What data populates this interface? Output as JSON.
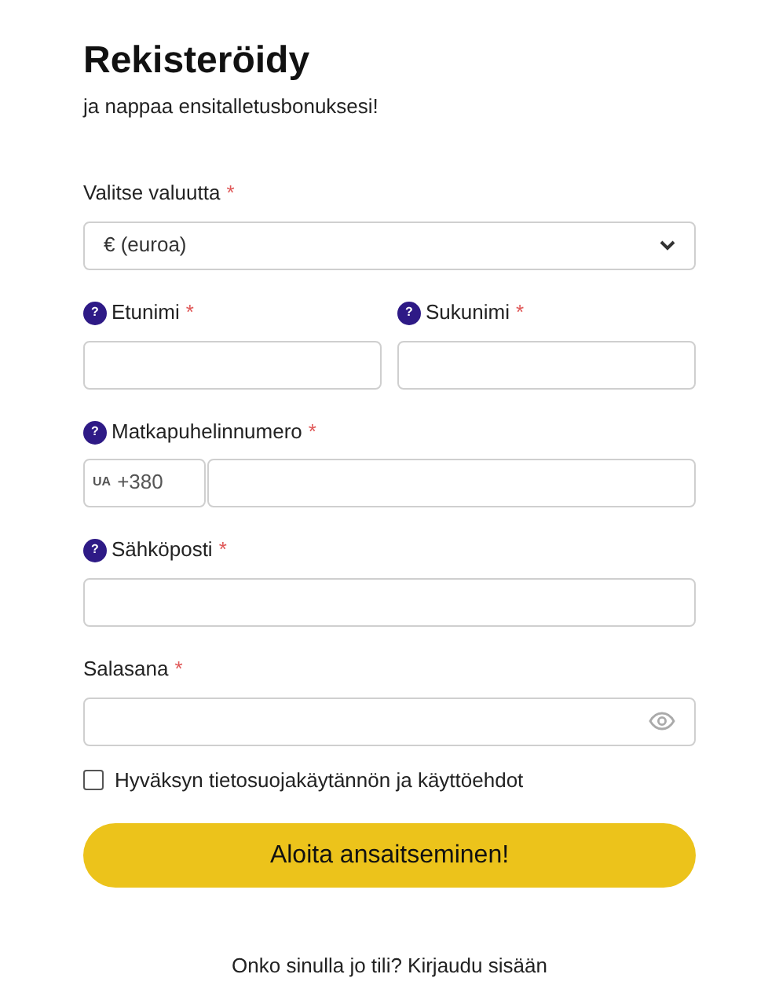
{
  "title": "Rekisteröidy",
  "subtitle": "ja nappaa ensitalletusbonuksesi!",
  "fields": [
    {
      "kind": "select",
      "label": "Valitse valuutta",
      "required_mark": "*",
      "value": "€ (euroa)"
    },
    {
      "kind": "name_pair",
      "items": [
        {
          "label": "Etunimi",
          "required_mark": "*",
          "help_mark": "?"
        },
        {
          "label": "Sukunimi",
          "required_mark": "*",
          "help_mark": "?"
        }
      ]
    },
    {
      "kind": "phone",
      "label": "Matkapuhelinnumero",
      "required_mark": "*",
      "help_mark": "?",
      "country": "UA",
      "code": "+380"
    },
    {
      "kind": "text",
      "label": "Sähköposti",
      "required_mark": "*",
      "help_mark": "?"
    },
    {
      "kind": "password",
      "label": "Salasana",
      "required_mark": "*"
    }
  ],
  "terms": {
    "label": "Hyväksyn tietosuojakäytännön ja käyttöehdot",
    "checked": false
  },
  "submit": "Aloita ansaitseminen!",
  "footer": "Onko sinulla jo tili? Kirjaudu sisään"
}
